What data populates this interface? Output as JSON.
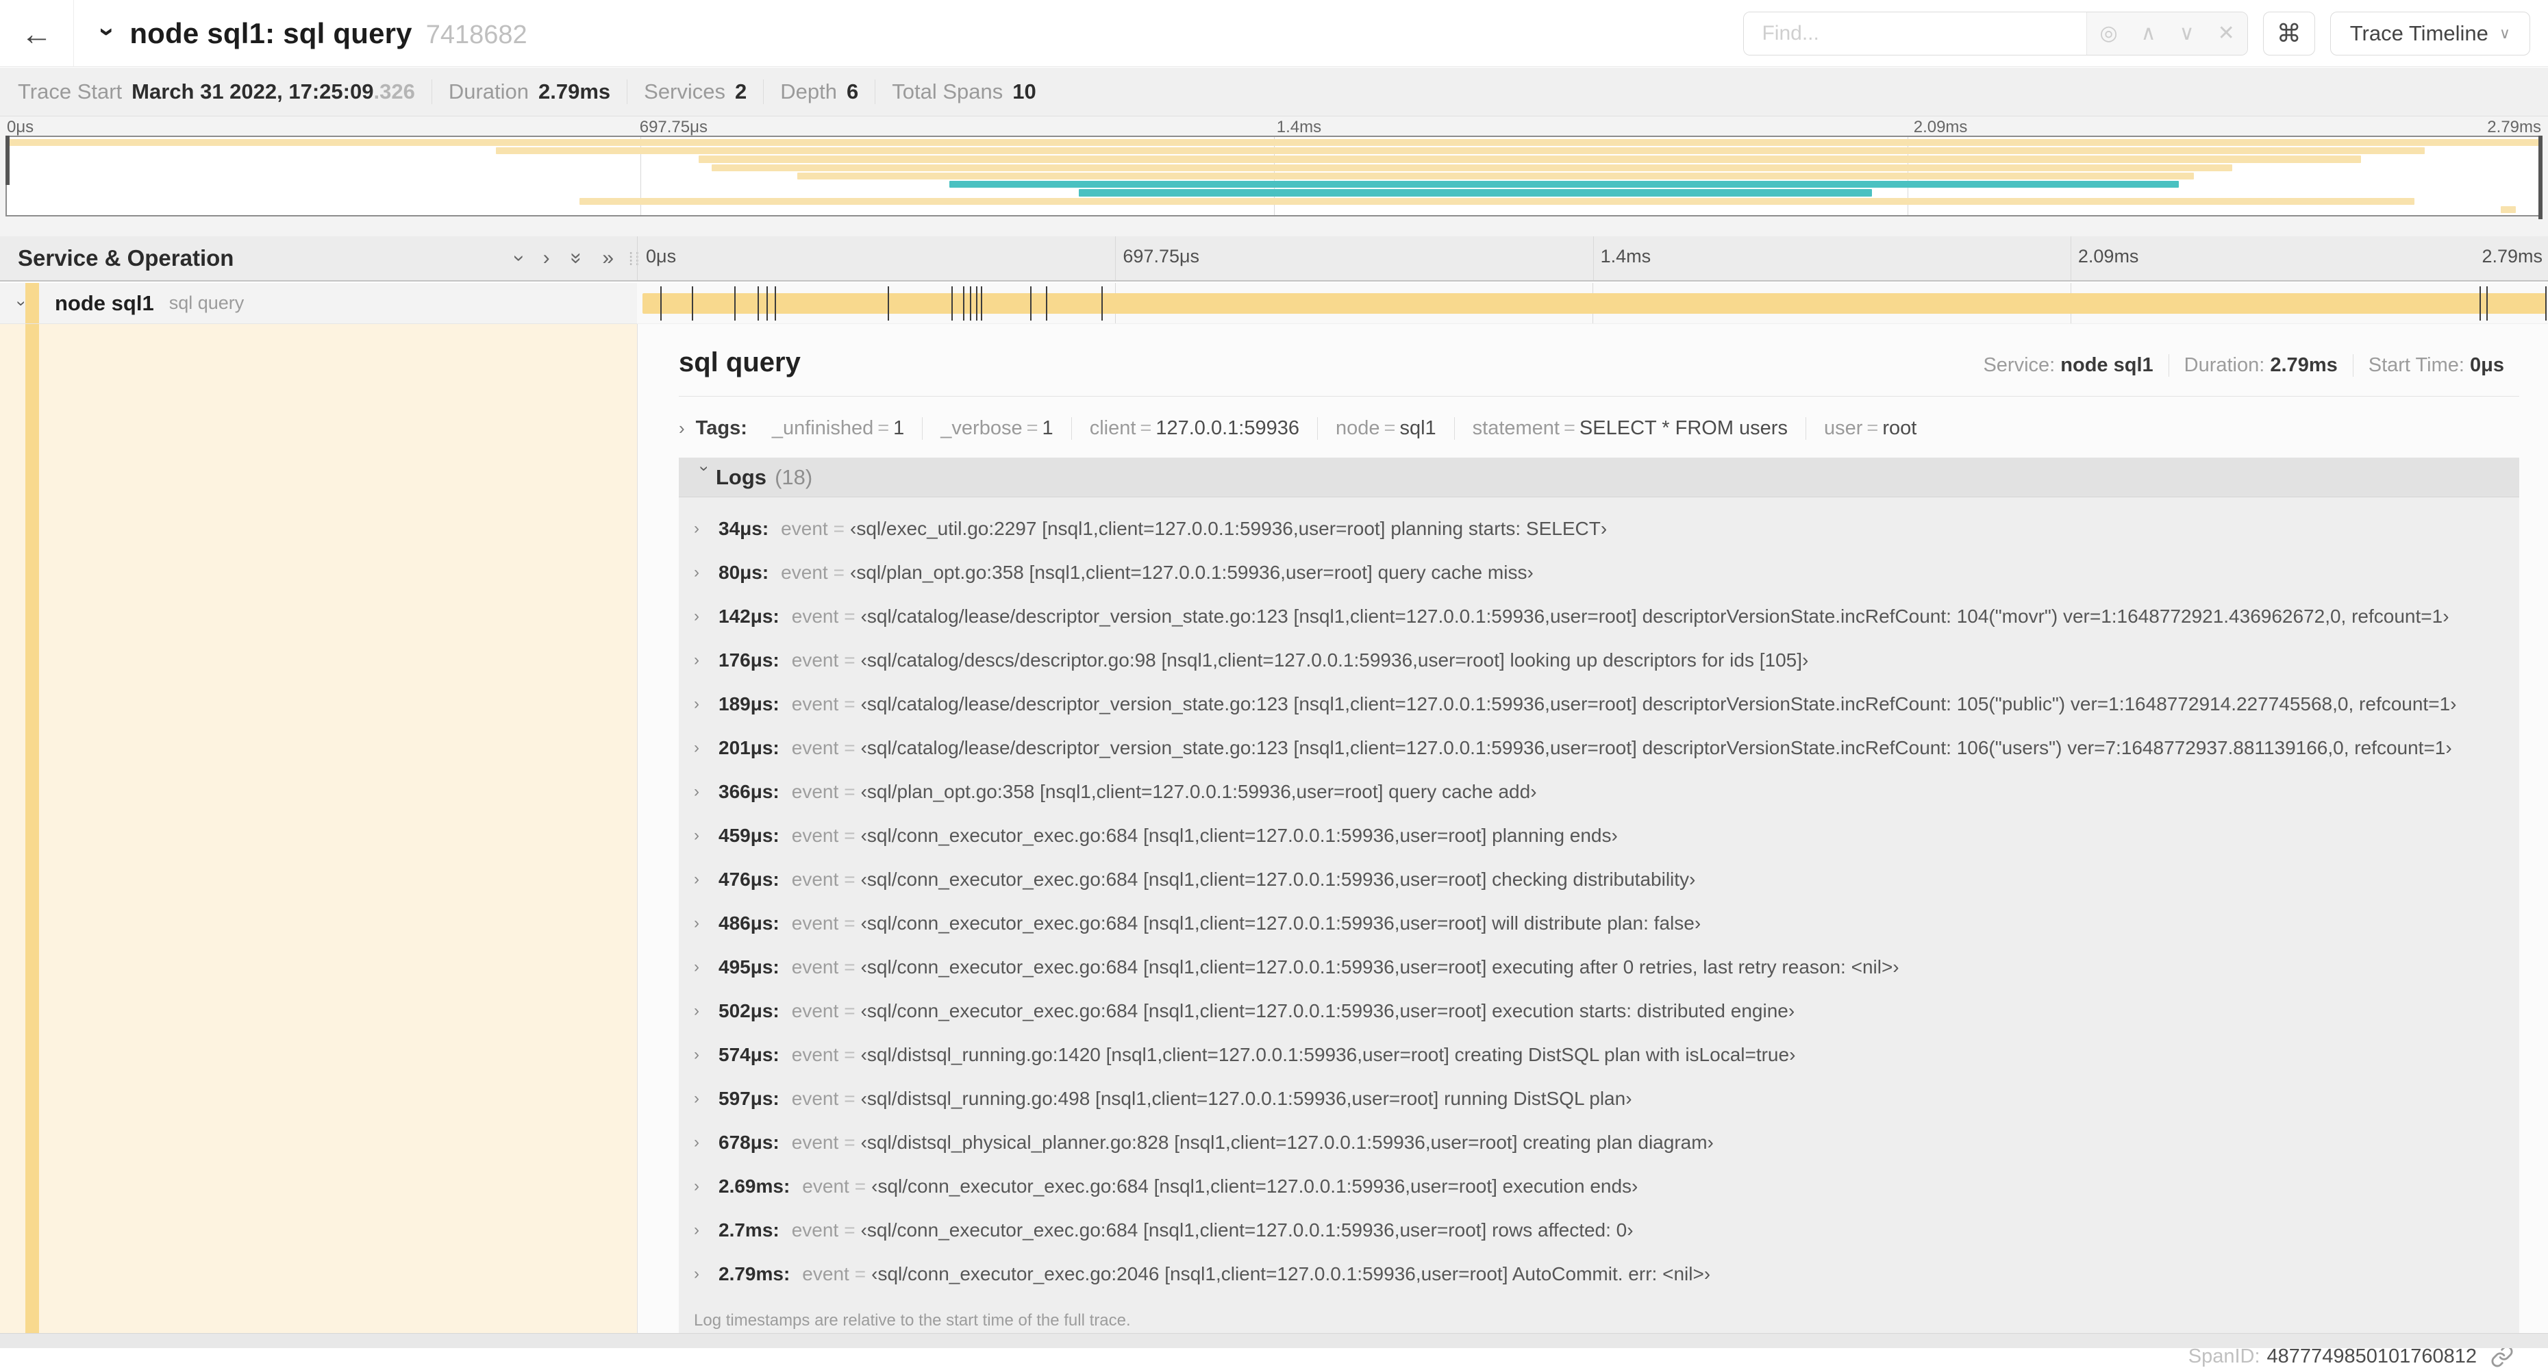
{
  "header": {
    "back_icon": "←",
    "title": "node sql1: sql query",
    "trace_id": "7418682",
    "find_placeholder": "Find...",
    "shortcut_glyph": "⌘",
    "view_selector": "Trace Timeline",
    "find_icons": {
      "target": "◎",
      "prev": "∧",
      "next": "∨",
      "clear": "✕"
    }
  },
  "trace_info": {
    "items": [
      {
        "label": "Trace Start",
        "value": "March 31 2022, 17:25:09",
        "suffix": ".326"
      },
      {
        "label": "Duration",
        "value": "2.79ms"
      },
      {
        "label": "Services",
        "value": "2"
      },
      {
        "label": "Depth",
        "value": "6"
      },
      {
        "label": "Total Spans",
        "value": "10"
      }
    ]
  },
  "colors": {
    "span_tan": "#f8d98e",
    "minimap_tan": "#f8e2ad",
    "minimap_teal": "#4ac1c1"
  },
  "minimap": {
    "ticks": [
      "0μs",
      "697.75μs",
      "1.4ms",
      "2.09ms",
      "2.79ms"
    ],
    "bars": [
      {
        "left": "0%",
        "width": "100%",
        "color": "#f8e2ad"
      },
      {
        "left": "19.3%",
        "width": "76.1%",
        "color": "#f8e2ad"
      },
      {
        "left": "27.3%",
        "width": "65.6%",
        "color": "#f8e2ad"
      },
      {
        "left": "27.8%",
        "width": "60%",
        "color": "#f8e2ad"
      },
      {
        "left": "31.2%",
        "width": "55.1%",
        "color": "#f8e2ad"
      },
      {
        "left": "37.2%",
        "width": "48.5%",
        "color": "#4ac1c1"
      },
      {
        "left": "42.3%",
        "width": "31.3%",
        "color": "#4ac1c1"
      },
      {
        "left": "22.6%",
        "width": "72.4%",
        "color": "#f8e2ad"
      },
      {
        "left": "98.4%",
        "width": "0.6%",
        "color": "#f8e2ad"
      }
    ]
  },
  "timeline": {
    "left_header": "Service & Operation",
    "ticks": [
      "0μs",
      "697.75μs",
      "1.4ms",
      "2.09ms",
      "2.79ms"
    ],
    "row": {
      "service": "node sql1",
      "operation": "sql query",
      "log_tick_positions": [
        "1.22%",
        "2.87%",
        "5.09%",
        "6.31%",
        "6.77%",
        "7.2%",
        "13.12%",
        "16.45%",
        "17.06%",
        "17.42%",
        "17.74%",
        "17.99%",
        "20.57%",
        "21.4%",
        "24.3%",
        "96.42%",
        "96.77%",
        "99.85%"
      ]
    }
  },
  "detail": {
    "title": "sql query",
    "meta": [
      {
        "label": "Service:",
        "value": "node sql1"
      },
      {
        "label": "Duration:",
        "value": "2.79ms"
      },
      {
        "label": "Start Time:",
        "value": "0μs"
      }
    ]
  },
  "tags": {
    "label": "Tags:",
    "eq": "=",
    "items": [
      {
        "key": "_unfinished",
        "value": "1"
      },
      {
        "key": "_verbose",
        "value": "1"
      },
      {
        "key": "client",
        "value": "127.0.0.1:59936"
      },
      {
        "key": "node",
        "value": "sql1"
      },
      {
        "key": "statement",
        "value": "SELECT * FROM users"
      },
      {
        "key": "user",
        "value": "root"
      }
    ]
  },
  "logs": {
    "title": "Logs",
    "count": "(18)",
    "field_label": "event",
    "eq": "=",
    "entries": [
      {
        "time": "34μs:",
        "value": "‹sql/exec_util.go:2297 [nsql1,client=127.0.0.1:59936,user=root] planning starts: SELECT›"
      },
      {
        "time": "80μs:",
        "value": "‹sql/plan_opt.go:358 [nsql1,client=127.0.0.1:59936,user=root] query cache miss›"
      },
      {
        "time": "142μs:",
        "value": "‹sql/catalog/lease/descriptor_version_state.go:123 [nsql1,client=127.0.0.1:59936,user=root] descriptorVersionState.incRefCount: 104(\"movr\") ver=1:1648772921.436962672,0, refcount=1›"
      },
      {
        "time": "176μs:",
        "value": "‹sql/catalog/descs/descriptor.go:98 [nsql1,client=127.0.0.1:59936,user=root] looking up descriptors for ids [105]›"
      },
      {
        "time": "189μs:",
        "value": "‹sql/catalog/lease/descriptor_version_state.go:123 [nsql1,client=127.0.0.1:59936,user=root] descriptorVersionState.incRefCount: 105(\"public\") ver=1:1648772914.227745568,0, refcount=1›"
      },
      {
        "time": "201μs:",
        "value": "‹sql/catalog/lease/descriptor_version_state.go:123 [nsql1,client=127.0.0.1:59936,user=root] descriptorVersionState.incRefCount: 106(\"users\") ver=7:1648772937.881139166,0, refcount=1›"
      },
      {
        "time": "366μs:",
        "value": "‹sql/plan_opt.go:358 [nsql1,client=127.0.0.1:59936,user=root] query cache add›"
      },
      {
        "time": "459μs:",
        "value": "‹sql/conn_executor_exec.go:684 [nsql1,client=127.0.0.1:59936,user=root] planning ends›"
      },
      {
        "time": "476μs:",
        "value": "‹sql/conn_executor_exec.go:684 [nsql1,client=127.0.0.1:59936,user=root] checking distributability›"
      },
      {
        "time": "486μs:",
        "value": "‹sql/conn_executor_exec.go:684 [nsql1,client=127.0.0.1:59936,user=root] will distribute plan: false›"
      },
      {
        "time": "495μs:",
        "value": "‹sql/conn_executor_exec.go:684 [nsql1,client=127.0.0.1:59936,user=root] executing after 0 retries, last retry reason: <nil>›"
      },
      {
        "time": "502μs:",
        "value": "‹sql/conn_executor_exec.go:684 [nsql1,client=127.0.0.1:59936,user=root] execution starts: distributed engine›"
      },
      {
        "time": "574μs:",
        "value": "‹sql/distsql_running.go:1420 [nsql1,client=127.0.0.1:59936,user=root] creating DistSQL plan with isLocal=true›"
      },
      {
        "time": "597μs:",
        "value": "‹sql/distsql_running.go:498 [nsql1,client=127.0.0.1:59936,user=root] running DistSQL plan›"
      },
      {
        "time": "678μs:",
        "value": "‹sql/distsql_physical_planner.go:828 [nsql1,client=127.0.0.1:59936,user=root] creating plan diagram›"
      },
      {
        "time": "2.69ms:",
        "value": "‹sql/conn_executor_exec.go:684 [nsql1,client=127.0.0.1:59936,user=root] execution ends›"
      },
      {
        "time": "2.7ms:",
        "value": "‹sql/conn_executor_exec.go:684 [nsql1,client=127.0.0.1:59936,user=root] rows affected: 0›"
      },
      {
        "time": "2.79ms:",
        "value": "‹sql/conn_executor_exec.go:2046 [nsql1,client=127.0.0.1:59936,user=root] AutoCommit. err: <nil>›"
      }
    ],
    "note": "Log timestamps are relative to the start time of the full trace."
  },
  "footer": {
    "spanid_label": "SpanID:",
    "spanid_value": "4877749850101760812"
  }
}
